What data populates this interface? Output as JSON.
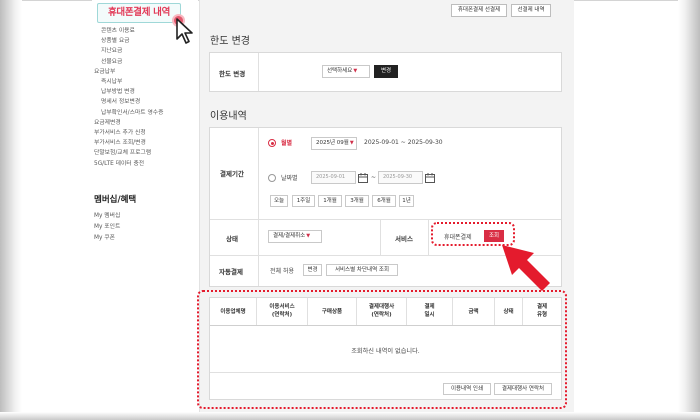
{
  "sidebar": {
    "active_item": "휴대폰결제 내역",
    "items": [
      {
        "label": "콘텐츠 이용료",
        "sub": true
      },
      {
        "label": "상품별 요금",
        "sub": true
      },
      {
        "label": "지난요금",
        "sub": true
      },
      {
        "label": "선물요금",
        "sub": true
      },
      {
        "label": "요금납부",
        "sub": false
      },
      {
        "label": "즉시납부",
        "sub": true
      },
      {
        "label": "납부방법 변경",
        "sub": true
      },
      {
        "label": "명세서 정보변경",
        "sub": true
      },
      {
        "label": "납부확인서/스마트 영수증",
        "sub": true
      },
      {
        "label": "요금제변경",
        "sub": false
      },
      {
        "label": "부가서비스 추가 신청",
        "sub": false
      },
      {
        "label": "부가서비스 조회/변경",
        "sub": false
      },
      {
        "label": "단말보험/교체 프로그램",
        "sub": false
      },
      {
        "label": "5G/LTE 데이터 충전",
        "sub": false
      }
    ],
    "membership_heading": "멤버십/혜택",
    "membership_items": [
      "My 멤버십",
      "My 포인트",
      "My 쿠폰"
    ]
  },
  "top_buttons": [
    "휴대폰결제 선결제",
    "선결제 내역"
  ],
  "limit_change": {
    "title": "한도 변경",
    "label": "한도 변경",
    "select_value": "선택하세요",
    "button": "변경"
  },
  "usage": {
    "title": "이용내역",
    "period_label": "결제기간",
    "monthly_label": "월별",
    "month_value": "2025년 09월",
    "month_range": "2025-09-01 ~ 2025-09-30",
    "daily_label": "날짜별",
    "date_from": "2025-09-01",
    "date_sep": "~",
    "date_to": "2025-09-30",
    "quick_ranges": [
      "오늘",
      "1주일",
      "1개월",
      "3개월",
      "6개월",
      "1년"
    ],
    "status_label": "상태",
    "status_value": "결제/결제취소",
    "service_label": "서비스",
    "service_value": "휴대폰결제",
    "search_button": "조회",
    "autopay_label": "자동결제",
    "autopay_value": "전체 허용",
    "autopay_change_button": "변경",
    "blocked_list_button": "서비스별 차단내역 조회"
  },
  "table": {
    "columns": [
      "이용업체명",
      "이용서비스\n(연락처)",
      "구매상품",
      "결제대행사\n(연락처)",
      "결제\n일시",
      "금액",
      "상태",
      "결제\n유형"
    ],
    "empty_message": "조회하신 내역이 없습니다.",
    "print_button": "이용내역 인쇄",
    "agency_button": "결제대행사 연락처"
  },
  "colors": {
    "accent_red": "#d92d44",
    "annotation_red": "#e41b2d",
    "highlight_border": "#9fd8d8"
  },
  "icons": {
    "calendar": "calendar-icon",
    "cursor": "mouse-pointer-icon",
    "arrow": "red-arrow-icon"
  }
}
